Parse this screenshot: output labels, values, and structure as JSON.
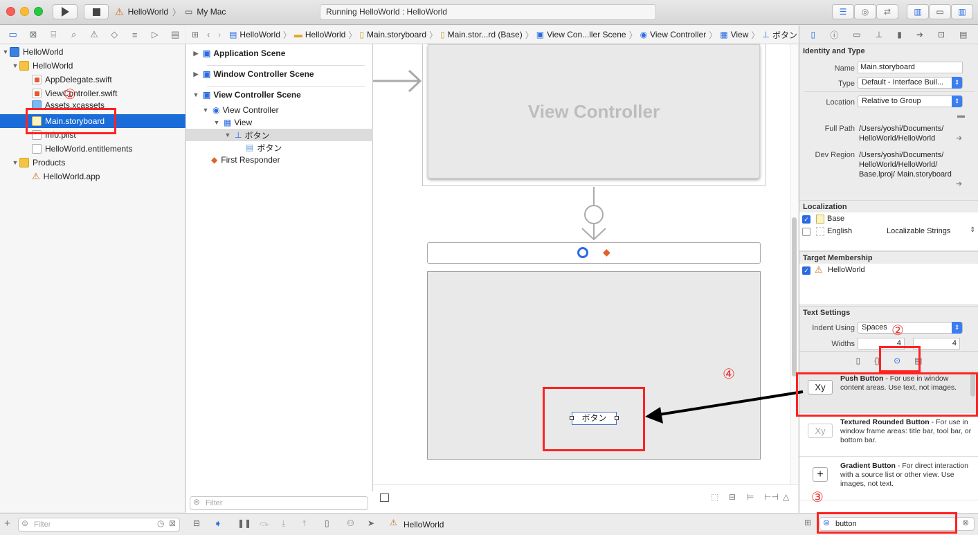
{
  "toolbar": {
    "scheme": "HelloWorld",
    "destination": "My Mac",
    "status": "Running HelloWorld : HelloWorld"
  },
  "navigator": {
    "items": [
      {
        "label": "HelloWorld",
        "type": "proj"
      },
      {
        "label": "HelloWorld",
        "type": "folder"
      },
      {
        "label": "AppDelegate.swift",
        "type": "swift"
      },
      {
        "label": "ViewController.swift",
        "type": "swift"
      },
      {
        "label": "Assets.xcassets",
        "type": "folder"
      },
      {
        "label": "Main.storyboard",
        "type": "sb"
      },
      {
        "label": "Info.plist",
        "type": "plain"
      },
      {
        "label": "HelloWorld.entitlements",
        "type": "plain"
      },
      {
        "label": "Products",
        "type": "folder"
      },
      {
        "label": "HelloWorld.app",
        "type": "app"
      }
    ],
    "filter_placeholder": "Filter"
  },
  "jumpbar": [
    "HelloWorld",
    "HelloWorld",
    "Main.storyboard",
    "Main.stor...rd (Base)",
    "View Con...ller Scene",
    "View Controller",
    "View",
    "ボタン"
  ],
  "outline": {
    "scenes": [
      "Application Scene",
      "Window Controller Scene",
      "View Controller Scene"
    ],
    "items": [
      "View Controller",
      "View",
      "ボタン",
      "ボタン",
      "First Responder"
    ],
    "filter_placeholder": "Filter"
  },
  "canvas": {
    "window_title": "View Controller",
    "button_label": "ボタン"
  },
  "inspector": {
    "identity_header": "Identity and Type",
    "name_label": "Name",
    "name_value": "Main.storyboard",
    "type_label": "Type",
    "type_value": "Default - Interface Buil...",
    "location_label": "Location",
    "location_value": "Relative to Group",
    "fullpath_label": "Full Path",
    "fullpath_value": "/Users/yoshi/Documents/ HelloWorld/HelloWorld",
    "devregion_label": "Dev Region",
    "devregion_value": "/Users/yoshi/Documents/ HelloWorld/HelloWorld/ Base.lproj/ Main.storyboard",
    "localization_header": "Localization",
    "loc_base": "Base",
    "loc_english": "English",
    "loc_strings": "Localizable Strings",
    "target_header": "Target Membership",
    "target_item": "HelloWorld",
    "text_header": "Text Settings",
    "indent_label": "Indent Using",
    "indent_value": "Spaces",
    "widths_label": "Widths",
    "tab_width": "4",
    "indent_width": "4"
  },
  "library": {
    "items": [
      {
        "icon": "Xy",
        "title": "Push Button",
        "desc": " - For use in window content areas. Use text, not images."
      },
      {
        "icon": "Xy",
        "title": "Textured Rounded Button",
        "desc": " - For use in window frame areas: title bar, tool bar, or bottom bar."
      },
      {
        "icon": "+",
        "title": "Gradient Button",
        "desc": " - For direct interaction with a source list or other view. Use images, not text."
      }
    ],
    "search_value": "button"
  },
  "bottom": {
    "scheme": "HelloWorld"
  },
  "annotations": [
    "①",
    "②",
    "③",
    "④"
  ]
}
